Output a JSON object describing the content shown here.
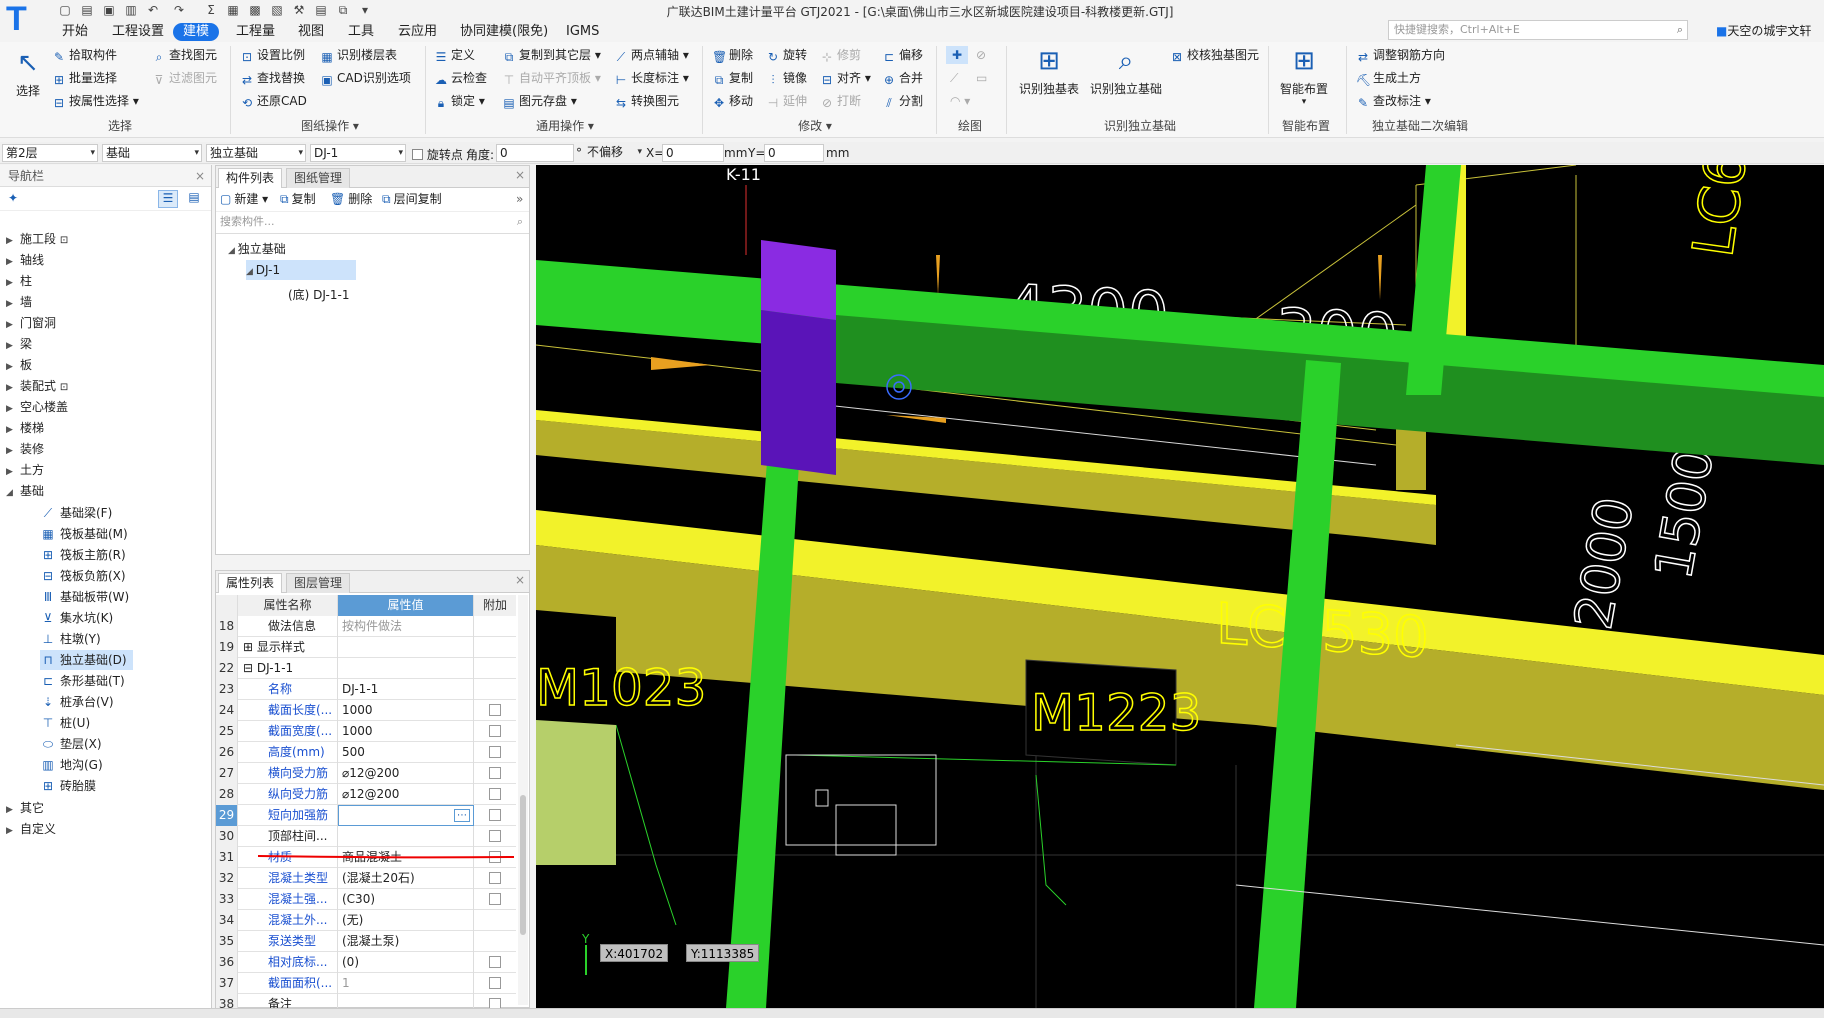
{
  "app": {
    "title": "广联达BIM土建计量平台 GTJ2021 - [G:\\桌面\\佛山市三水区新城医院建设项目-科教楼更新.GTJ]",
    "search_placeholder": "快捷键搜索，Ctrl+Alt+E",
    "user": "天空の城宇文轩"
  },
  "menu": [
    "开始",
    "工程设置",
    "建模",
    "工程量",
    "视图",
    "工具",
    "云应用",
    "协同建模(限免)",
    "IGMS"
  ],
  "menu_active": 2,
  "ribbon": {
    "select": {
      "big": "选择",
      "items": [
        "拾取构件",
        "批量选择",
        "按属性选择"
      ],
      "group": "选择"
    },
    "find": {
      "items": [
        "查找图元",
        "过滤图元"
      ]
    },
    "drawing_ops": {
      "items": [
        "设置比例",
        "查找替换",
        "还原CAD",
        "识别楼层表",
        "CAD识别选项"
      ],
      "group": "图纸操作"
    },
    "general_ops": {
      "items": [
        "定义",
        "云检查",
        "锁定",
        "复制到其它层",
        "自动平齐顶板",
        "图元存盘",
        "两点辅轴",
        "长度标注",
        "转换图元"
      ],
      "group": "通用操作"
    },
    "modify": {
      "items": [
        "删除",
        "旋转",
        "修剪",
        "偏移",
        "复制",
        "镜像",
        "对齐",
        "合并",
        "移动",
        "延伸",
        "打断",
        "分割"
      ],
      "group": "修改"
    },
    "draw": {
      "group": "绘图"
    },
    "identify": {
      "items": [
        "识别独基表",
        "识别独立基础",
        "校核独基图元"
      ],
      "group": "识别独立基础"
    },
    "smart": {
      "big": "智能布置",
      "group": "智能布置"
    },
    "secondary": {
      "items": [
        "调整钢筋方向",
        "生成土方",
        "查改标注"
      ],
      "group": "独立基础二次编辑"
    }
  },
  "options": {
    "floor": "第2层",
    "type": "基础",
    "subtype": "独立基础",
    "component": "DJ-1",
    "rotate_label": "旋转点",
    "angle_label": "角度:",
    "angle": "0",
    "angle_unit": "°",
    "offset": "不偏移",
    "x_label": "X=",
    "x": "0",
    "y_label": "Y=",
    "y": "0",
    "unit": "mm"
  },
  "nav": {
    "title": "导航栏",
    "items": [
      "施工段",
      "轴线",
      "柱",
      "墙",
      "门窗洞",
      "梁",
      "板",
      "装配式",
      "空心楼盖",
      "楼梯",
      "装修",
      "土方",
      "基础"
    ],
    "sub": [
      "基础梁(F)",
      "筏板基础(M)",
      "筏板主筋(R)",
      "筏板负筋(X)",
      "基础板带(W)",
      "集水坑(K)",
      "柱墩(Y)",
      "独立基础(D)",
      "条形基础(T)",
      "桩承台(V)",
      "桩(U)",
      "垫层(X)",
      "地沟(G)",
      "砖胎膜"
    ],
    "after": [
      "其它",
      "自定义"
    ]
  },
  "components": {
    "tabs": [
      "构件列表",
      "图纸管理"
    ],
    "tools": [
      "新建",
      "复制",
      "删除",
      "层间复制"
    ],
    "search_placeholder": "搜索构件...",
    "tree": {
      "root": "独立基础",
      "node": "DJ-1",
      "leaf": "(底) DJ-1-1"
    }
  },
  "properties": {
    "tabs": [
      "属性列表",
      "图层管理"
    ],
    "headers": [
      "属性名称",
      "属性值",
      "附加"
    ],
    "rows": [
      {
        "n": "18",
        "k": "做法信息",
        "v": "按构件做法",
        "style": "blk",
        "gray": true,
        "cb": false
      },
      {
        "n": "19",
        "k": "显示样式",
        "v": "",
        "style": "grp",
        "cb": false
      },
      {
        "n": "22",
        "k": "DJ-1-1",
        "v": "",
        "style": "grp2",
        "cb": false
      },
      {
        "n": "23",
        "k": "名称",
        "v": "DJ-1-1",
        "style": "blue",
        "cb": false
      },
      {
        "n": "24",
        "k": "截面长度(...",
        "v": "1000",
        "style": "blue",
        "cb": true
      },
      {
        "n": "25",
        "k": "截面宽度(...",
        "v": "1000",
        "style": "blue",
        "cb": true
      },
      {
        "n": "26",
        "k": "高度(mm)",
        "v": "500",
        "style": "blue",
        "cb": true
      },
      {
        "n": "27",
        "k": "横向受力筋",
        "v": "⌀12@200",
        "style": "blue",
        "cb": true
      },
      {
        "n": "28",
        "k": "纵向受力筋",
        "v": "⌀12@200",
        "style": "blue",
        "cb": true
      },
      {
        "n": "29",
        "k": "短向加强筋",
        "v": "",
        "style": "blue",
        "cb": true,
        "editing": true
      },
      {
        "n": "30",
        "k": "顶部柱间...",
        "v": "",
        "style": "blk",
        "cb": true
      },
      {
        "n": "31",
        "k": "材质",
        "v": "商品混凝土",
        "style": "blue",
        "cb": true
      },
      {
        "n": "32",
        "k": "混凝土类型",
        "v": "(混凝土20石)",
        "style": "blue",
        "cb": true
      },
      {
        "n": "33",
        "k": "混凝土强...",
        "v": "(C30)",
        "style": "blue",
        "cb": true
      },
      {
        "n": "34",
        "k": "混凝土外...",
        "v": "(无)",
        "style": "blue",
        "cb": false
      },
      {
        "n": "35",
        "k": "泵送类型",
        "v": "(混凝土泵)",
        "style": "blue",
        "cb": false
      },
      {
        "n": "36",
        "k": "相对底标...",
        "v": "(0)",
        "style": "blue",
        "cb": true
      },
      {
        "n": "37",
        "k": "截面面积(...",
        "v": "1",
        "style": "blue",
        "gray": true,
        "cb": true
      },
      {
        "n": "38",
        "k": "备注",
        "v": "",
        "style": "blk",
        "cb": true
      }
    ]
  },
  "cad": {
    "labels": [
      "K-11",
      "4300",
      "300",
      "LC4530",
      "M1023",
      "M1223",
      "LC6",
      "2000",
      "1500"
    ],
    "coord_x": "X:401702",
    "coord_y": "Y:1113385",
    "colors": {
      "beam": "#2ad12a",
      "wall": "#b5ae2a",
      "wall_top": "#f2f22a",
      "column": "#7b1fe0",
      "bg": "#000000"
    }
  }
}
